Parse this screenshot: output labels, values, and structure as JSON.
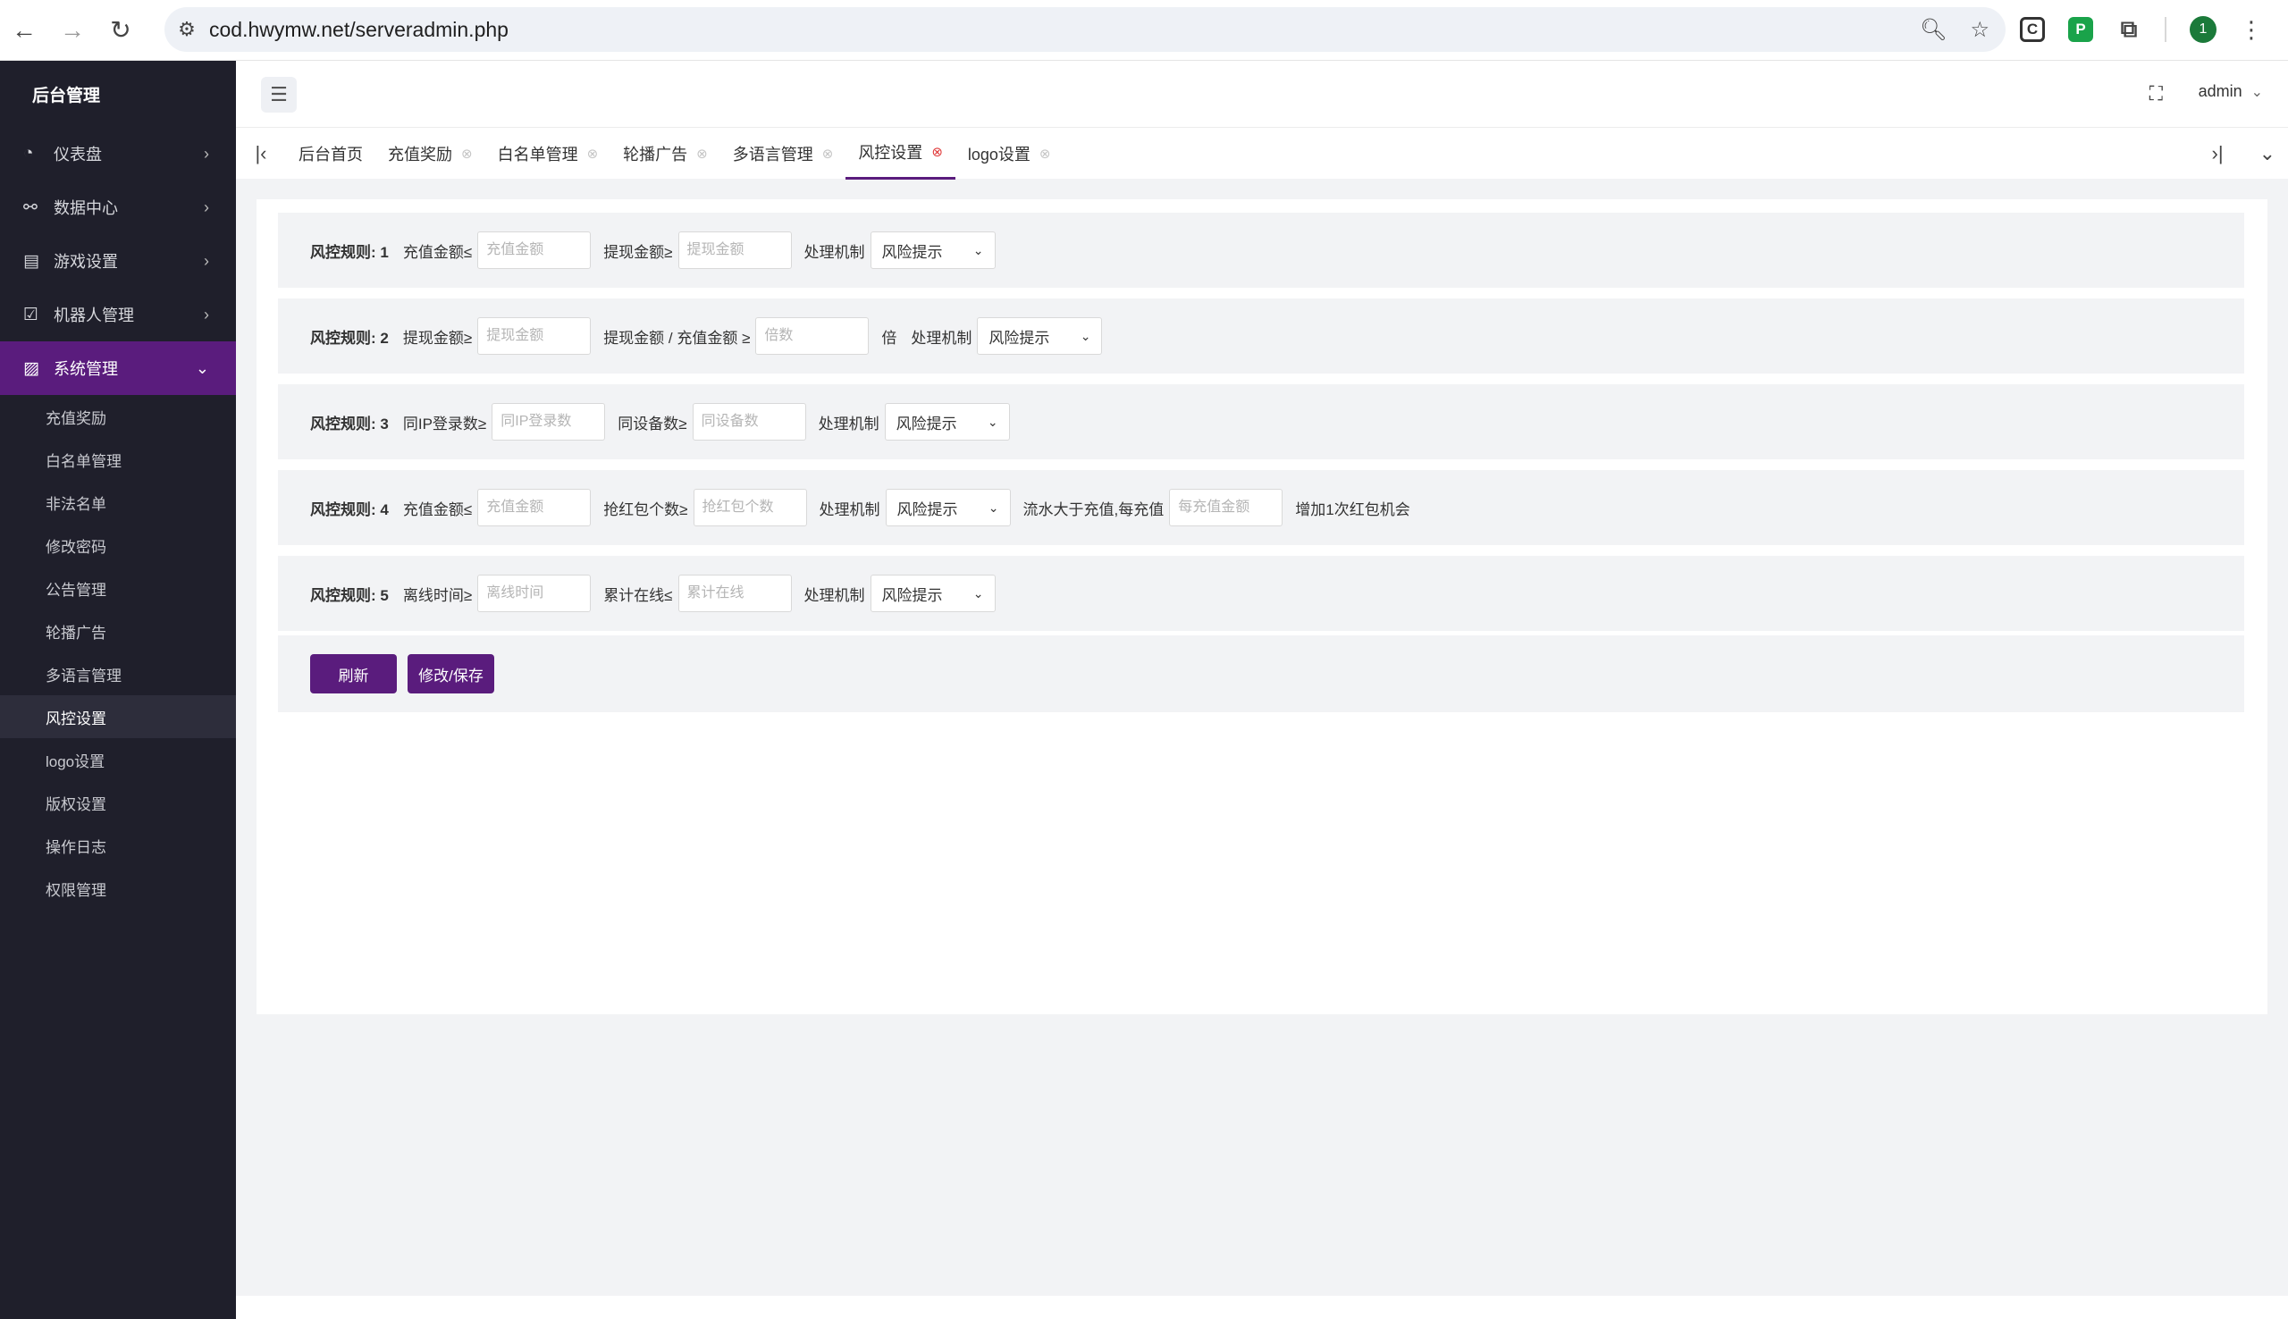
{
  "browser": {
    "url": "cod.hwymw.net/serveradmin.php",
    "profile_initial": "1"
  },
  "sidebar": {
    "brand": "后台管理",
    "menus": [
      {
        "label": "仪表盘",
        "icon": "dashboard-icon"
      },
      {
        "label": "数据中心",
        "icon": "data-center-icon"
      },
      {
        "label": "游戏设置",
        "icon": "game-settings-icon"
      },
      {
        "label": "机器人管理",
        "icon": "robot-icon"
      },
      {
        "label": "系统管理",
        "icon": "system-icon"
      }
    ],
    "sub_items": [
      "充值奖励",
      "白名单管理",
      "非法名单",
      "修改密码",
      "公告管理",
      "轮播广告",
      "多语言管理",
      "风控设置",
      "logo设置",
      "版权设置",
      "操作日志",
      "权限管理"
    ],
    "active_sub": "风控设置"
  },
  "header": {
    "user": "admin"
  },
  "tabs": [
    "后台首页",
    "充值奖励",
    "白名单管理",
    "轮播广告",
    "多语言管理",
    "风控设置",
    "logo设置"
  ],
  "rules": {
    "r1": {
      "title": "风控规则: 1",
      "l1": "充值金额≤",
      "p1": "充值金额",
      "l2": "提现金额≥",
      "p2": "提现金额",
      "l3": "处理机制",
      "sel": "风险提示"
    },
    "r2": {
      "title": "风控规则: 2",
      "l1": "提现金额≥",
      "p1": "提现金额",
      "l2": "提现金额 / 充值金额 ≥",
      "p2": "倍数",
      "unit": "倍",
      "l3": "处理机制",
      "sel": "风险提示"
    },
    "r3": {
      "title": "风控规则: 3",
      "l1": "同IP登录数≥",
      "p1": "同IP登录数",
      "l2": "同设备数≥",
      "p2": "同设备数",
      "l3": "处理机制",
      "sel": "风险提示"
    },
    "r4": {
      "title": "风控规则: 4",
      "l1": "充值金额≤",
      "p1": "充值金额",
      "l2": "抢红包个数≥",
      "p2": "抢红包个数",
      "l3": "处理机制",
      "sel": "风险提示",
      "l4": "流水大于充值,每充值",
      "p4": "每充值金额",
      "l5": "增加1次红包机会"
    },
    "r5": {
      "title": "风控规则: 5",
      "l1": "离线时间≥",
      "p1": "离线时间",
      "l2": "累计在线≤",
      "p2": "累计在线",
      "l3": "处理机制",
      "sel": "风险提示"
    }
  },
  "buttons": {
    "refresh": "刷新",
    "save": "修改/保存"
  },
  "colors": {
    "accent": "#5a1c7d",
    "sidebar_bg": "#1f1f2b"
  }
}
